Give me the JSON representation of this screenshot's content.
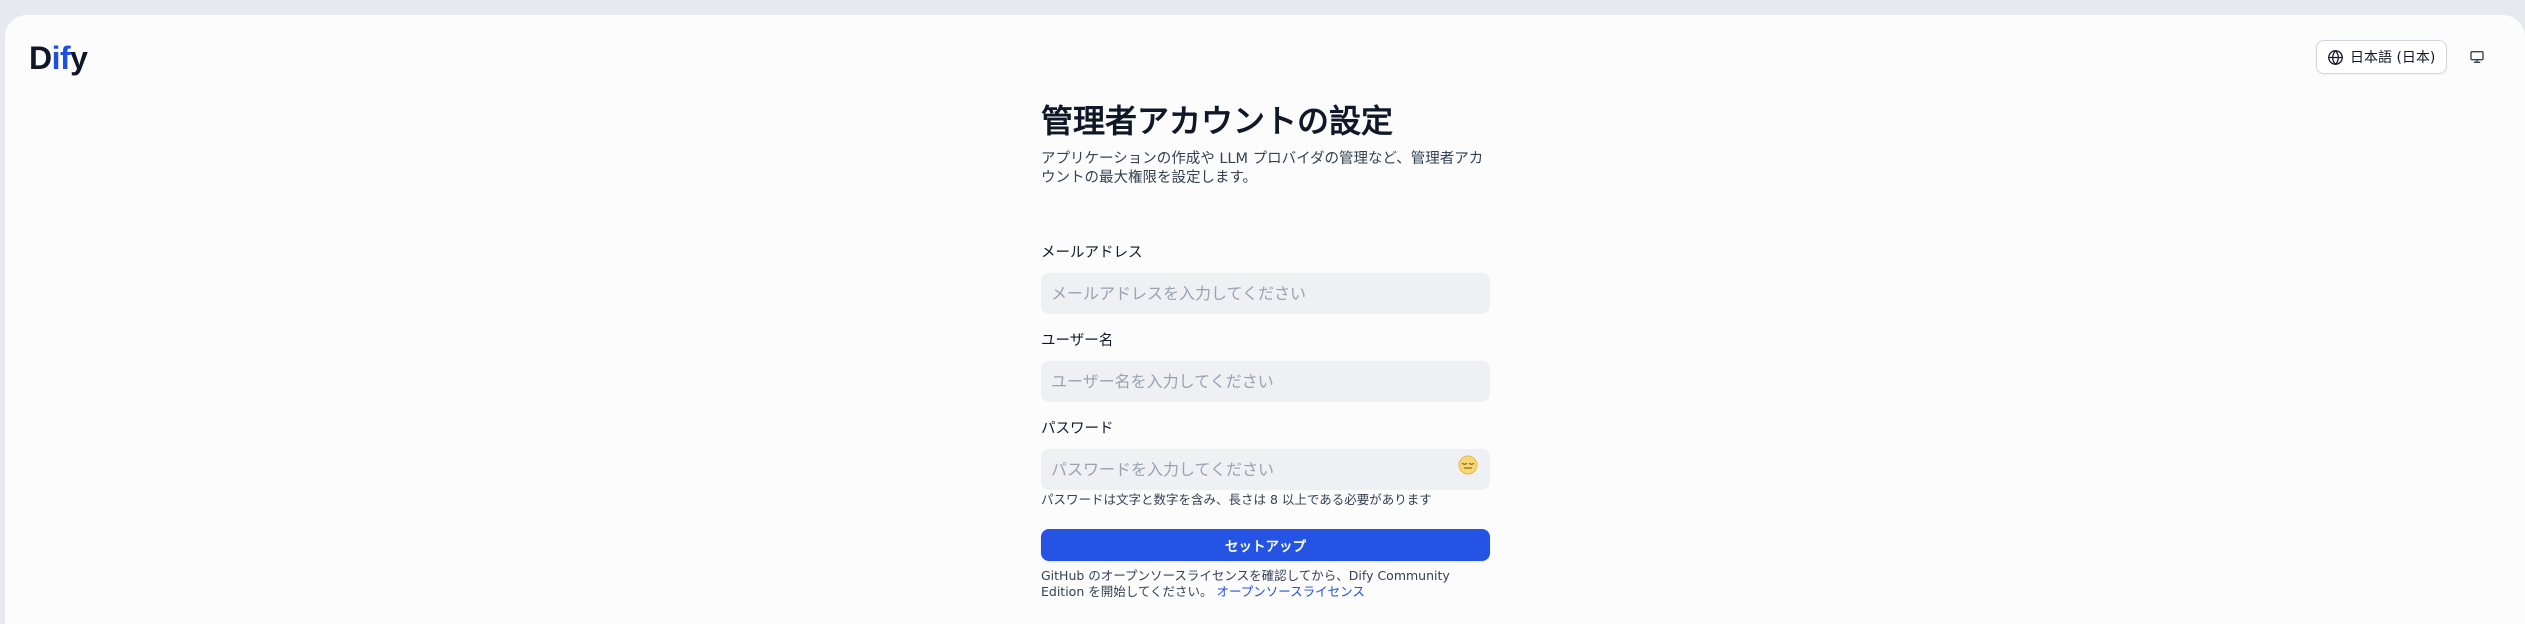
{
  "header": {
    "logo": {
      "part1": "D",
      "part2": "if",
      "part3": "y"
    },
    "language_label": "日本語 (日本)"
  },
  "form": {
    "title": "管理者アカウントの設定",
    "subtitle": "アプリケーションの作成や LLM プロバイダの管理など、管理者アカウントの最大権限を設定します。",
    "email": {
      "label": "メールアドレス",
      "value": "",
      "placeholder": "メールアドレスを入力してください"
    },
    "username": {
      "label": "ユーザー名",
      "value": "",
      "placeholder": "ユーザー名を入力してください"
    },
    "password": {
      "label": "パスワード",
      "value": "",
      "placeholder": "パスワードを入力してください"
    },
    "password_hint": "パスワードは文字と数字を含み、長さは 8 以上である必要があります",
    "submit_label": "セットアップ",
    "license_text": "GitHub のオープンソースライセンスを確認してから、Dify Community Edition を開始してください。",
    "license_link": "オープンソースライセンス"
  },
  "colors": {
    "primary": "#2554e4",
    "logo_accent": "#1f4fe0",
    "input_bg": "#eff0f3"
  },
  "icons": [
    "globe-icon",
    "monitor-icon",
    "eye-closed-icon"
  ]
}
